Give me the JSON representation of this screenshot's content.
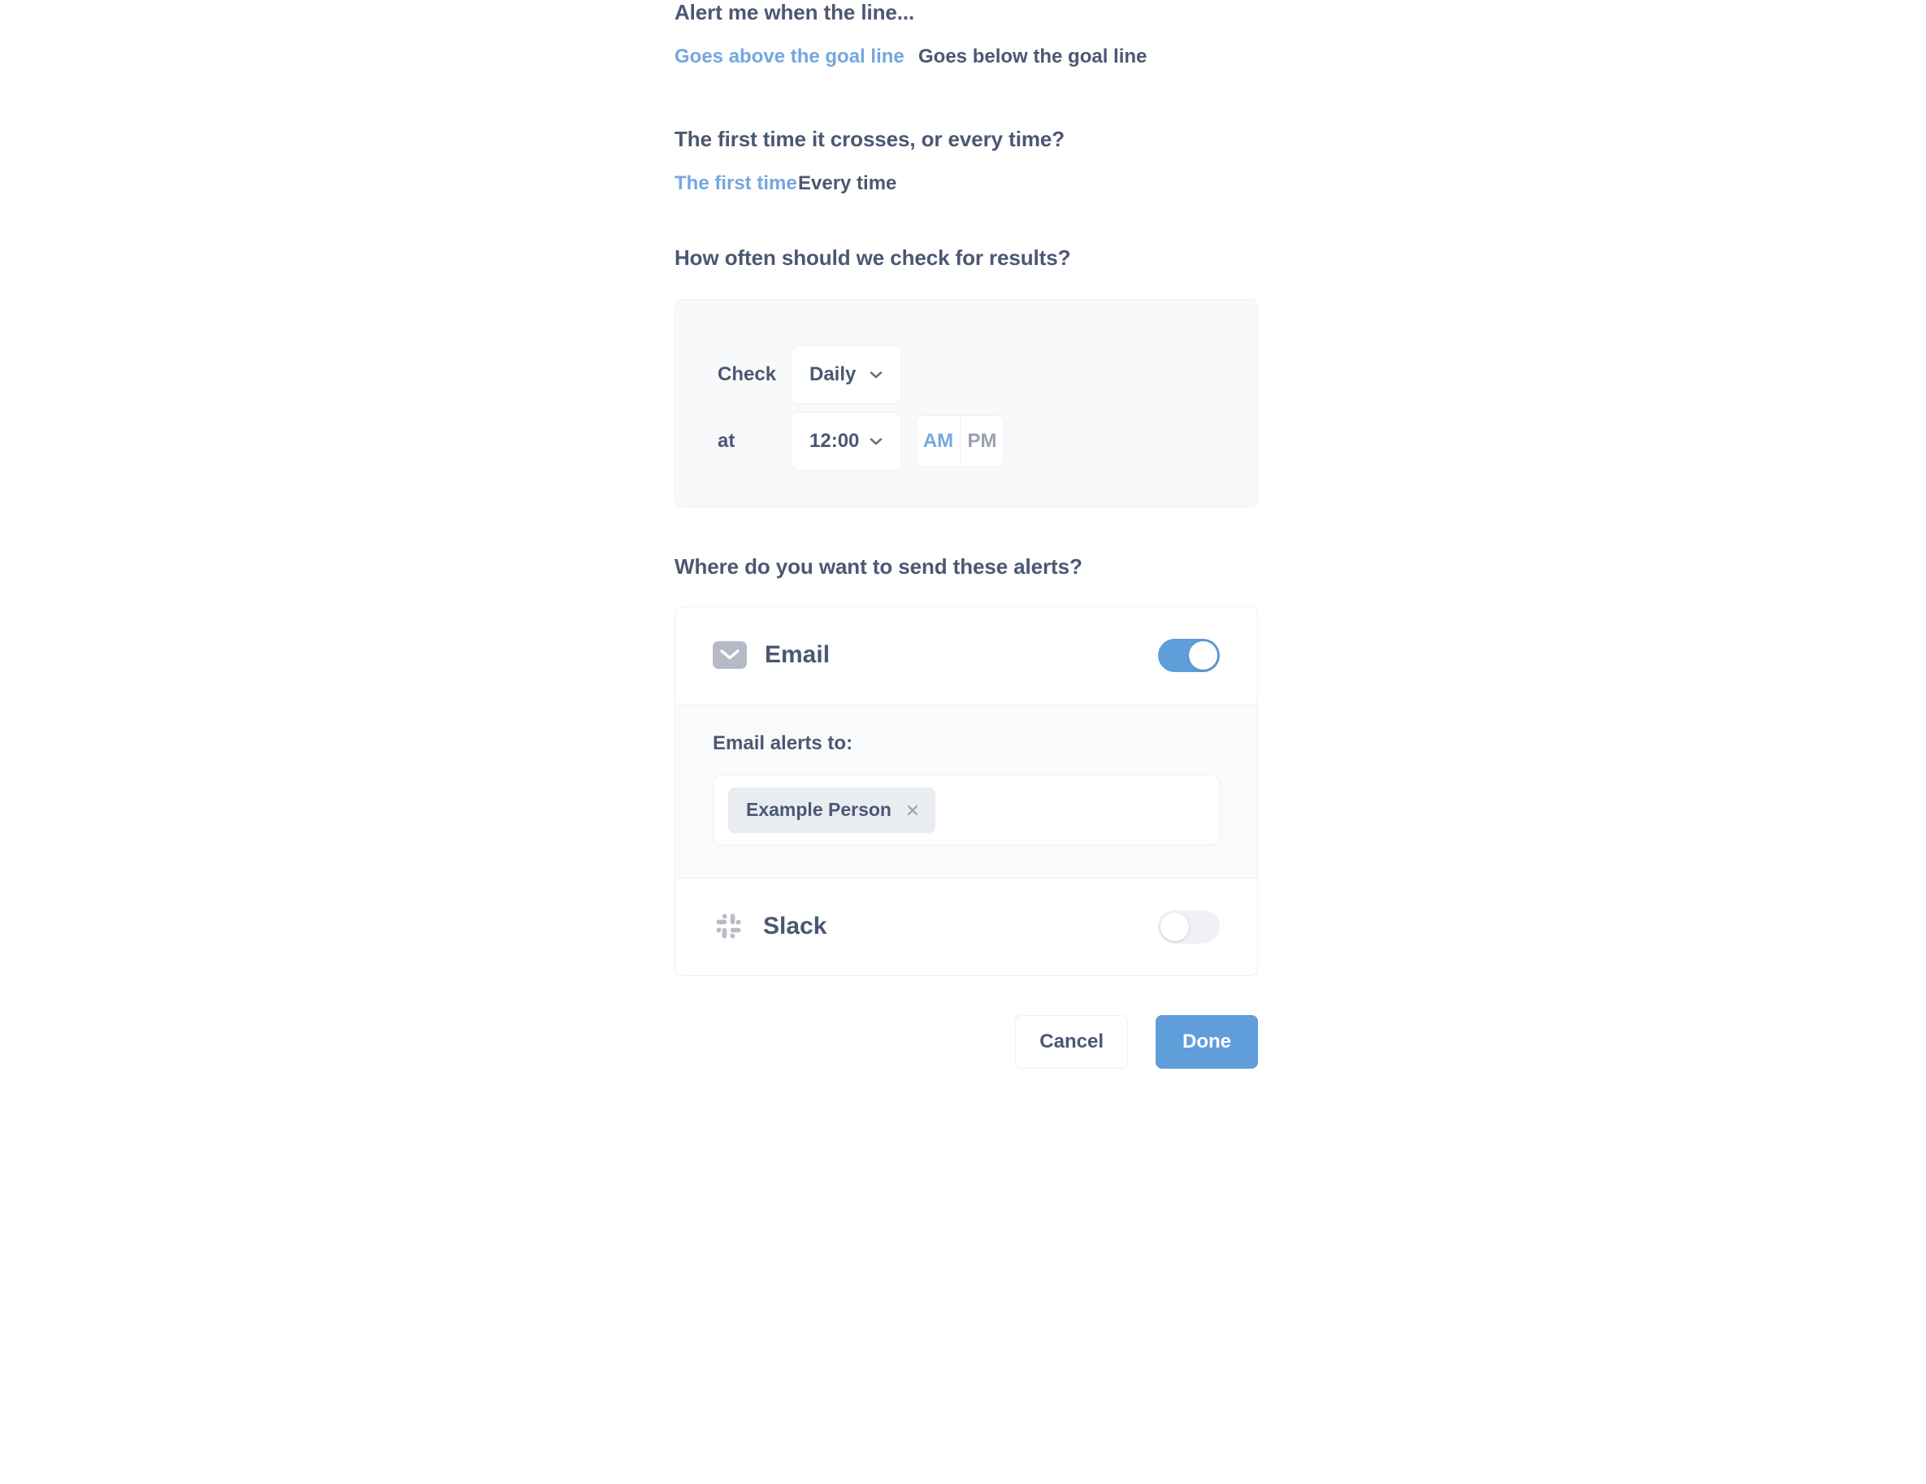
{
  "direction": {
    "title": "Alert me when the line...",
    "options": [
      {
        "label": "Goes above the goal line",
        "active": true
      },
      {
        "label": "Goes below the goal line",
        "active": false
      }
    ]
  },
  "frequency": {
    "title": "The first time it crosses, or every time?",
    "options": [
      {
        "label": "The first time",
        "active": true
      },
      {
        "label": "Every time",
        "active": false
      }
    ]
  },
  "schedule": {
    "title": "How often should we check for results?",
    "check_label": "Check",
    "check_value": "Daily",
    "at_label": "at",
    "at_value": "12:00",
    "meridiem": [
      {
        "label": "AM",
        "active": true
      },
      {
        "label": "PM",
        "active": false
      }
    ]
  },
  "channels": {
    "title": "Where do you want to send these alerts?",
    "email": {
      "name": "Email",
      "enabled": true,
      "recipients_label": "Email alerts to:",
      "recipients": [
        {
          "label": "Example Person",
          "remove": "×"
        }
      ]
    },
    "slack": {
      "name": "Slack",
      "enabled": false
    }
  },
  "footer": {
    "cancel_label": "Cancel",
    "done_label": "Done"
  },
  "colors": {
    "accent_blue": "#609ddb",
    "link_blue": "#74a7e0",
    "text_dark": "#4c5773",
    "muted_gray": "#9aa0ae",
    "panel_bg": "#f8f9fb",
    "border": "#eef0f2"
  }
}
